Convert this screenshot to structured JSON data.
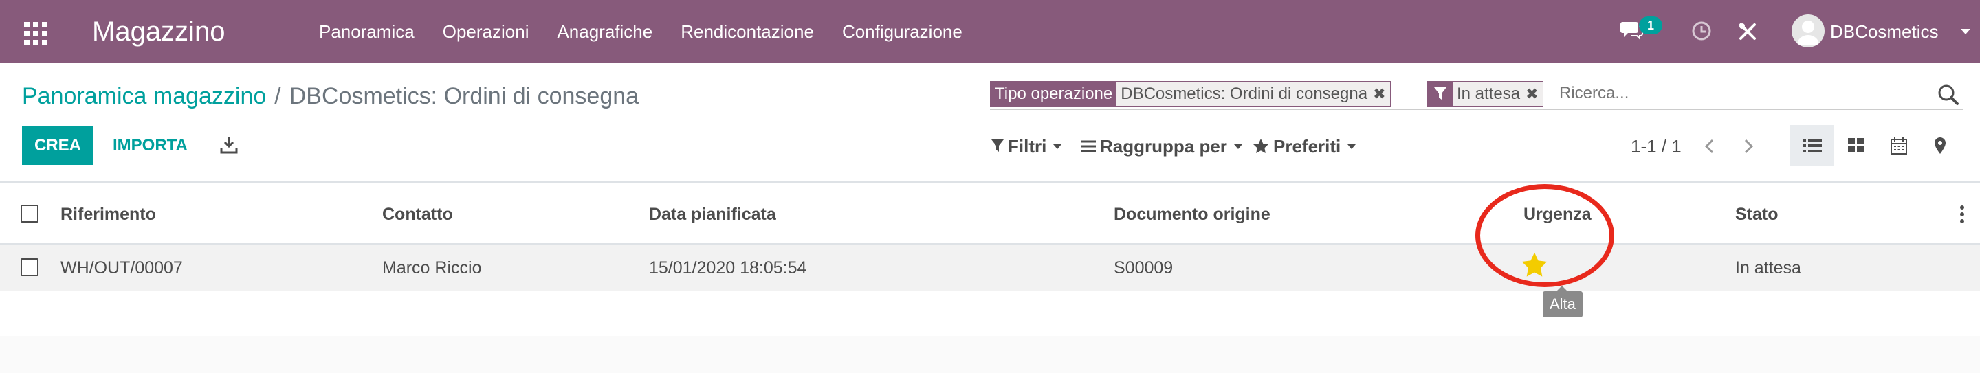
{
  "navbar": {
    "app_name": "Magazzino",
    "menu": [
      "Panoramica",
      "Operazioni",
      "Anagrafiche",
      "Rendicontazione",
      "Configurazione"
    ],
    "chat_count": "1",
    "user_name": "DBCosmetics",
    "icons": [
      "apps-icon",
      "chat-icon",
      "clock-icon",
      "debug-icon",
      "avatar"
    ],
    "background_color": "#875a7b"
  },
  "breadcrumb": {
    "parent": "Panoramica magazzino",
    "separator": "/",
    "current": "DBCosmetics: Ordini di consegna"
  },
  "search": {
    "facets": [
      {
        "label": "Tipo operazione",
        "value": "DBCosmetics: Ordini di consegna"
      },
      {
        "icon": "filter-icon",
        "value": "In attesa"
      }
    ],
    "placeholder": "Ricerca..."
  },
  "buttons": {
    "create": "CREA",
    "import": "IMPORTA"
  },
  "controls": {
    "filters": "Filtri",
    "group_by": "Raggruppa per",
    "favorites": "Preferiti"
  },
  "pager": {
    "value": "1-1 / 1"
  },
  "views": [
    "list",
    "kanban",
    "calendar",
    "map"
  ],
  "active_view": "list",
  "accent_color": "#00a09d",
  "table": {
    "columns": [
      "Riferimento",
      "Contatto",
      "Data pianificata",
      "Documento origine",
      "Urgenza",
      "Stato"
    ],
    "rows": [
      {
        "reference": "WH/OUT/00007",
        "contact": "Marco Riccio",
        "scheduled_date": "15/01/2020 18:05:54",
        "source_document": "S00009",
        "priority_icon": "star-icon",
        "priority_color": "#f3cc00",
        "status": "In attesa"
      }
    ]
  },
  "tooltip": "Alta",
  "annotation": {
    "shape": "circle",
    "color": "#e8291c"
  }
}
